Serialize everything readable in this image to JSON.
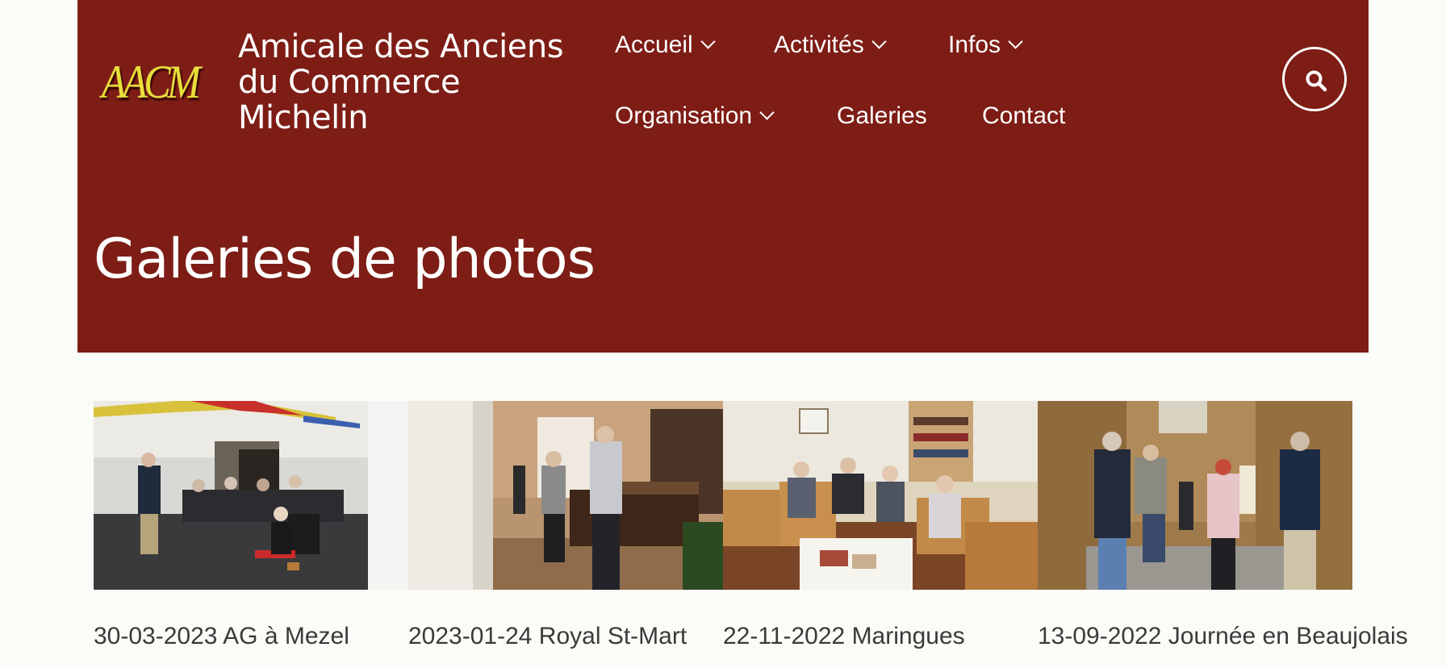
{
  "header": {
    "logo_text": "AACM",
    "site_name_lines": [
      "Amicale des Anciens",
      "du Commerce",
      "Michelin"
    ]
  },
  "nav": {
    "items": [
      {
        "label": "Accueil",
        "dropdown": true
      },
      {
        "label": "Activités",
        "dropdown": true
      },
      {
        "label": "Infos",
        "dropdown": true
      },
      {
        "label": "Organisation",
        "dropdown": true
      },
      {
        "label": "Galeries",
        "dropdown": false
      },
      {
        "label": "Contact",
        "dropdown": false
      }
    ],
    "search_icon": "search-icon"
  },
  "page": {
    "title": "Galeries de photos"
  },
  "galleries": [
    {
      "caption": "30-03-2023 AG à Mezel",
      "image": "meeting-room-photo"
    },
    {
      "caption": "2023-01-24 Royal St-Mart",
      "image": "hotel-lobby-photo"
    },
    {
      "caption": "22-11-2022 Maringues",
      "image": "lounge-photo"
    },
    {
      "caption": "13-09-2022 Journée en Beaujolais",
      "image": "village-street-photo"
    }
  ],
  "colors": {
    "banner": "#7d1d15",
    "background": "#fbfbf7",
    "text": "#3a3a3a",
    "logo": "#e8de3a"
  }
}
